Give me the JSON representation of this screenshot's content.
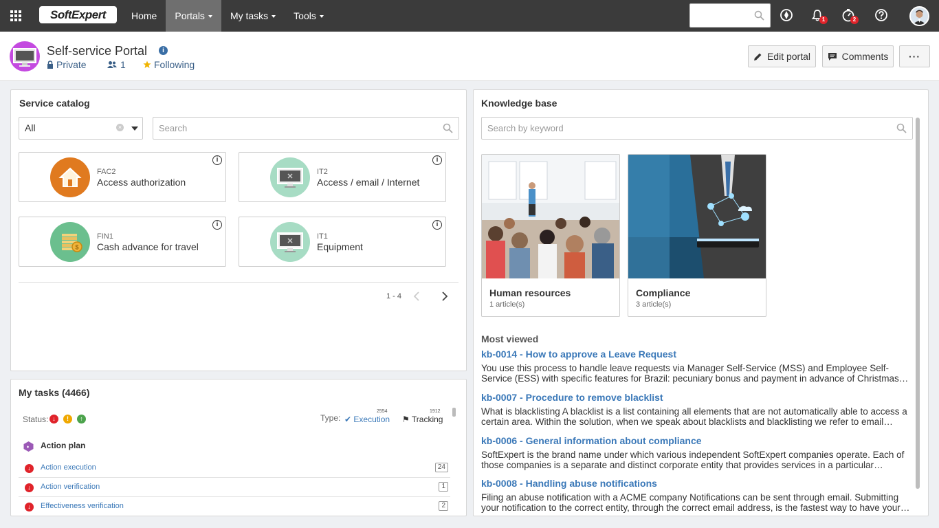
{
  "topbar": {
    "logo": "SoftExpert",
    "nav": [
      {
        "label": "Home",
        "caret": false,
        "active": false
      },
      {
        "label": "Portals",
        "caret": true,
        "active": true
      },
      {
        "label": "My tasks",
        "caret": true,
        "active": false
      },
      {
        "label": "Tools",
        "caret": true,
        "active": false
      }
    ],
    "notifications_badge": "1",
    "timer_badge": "2"
  },
  "header": {
    "title": "Self-service Portal",
    "privacy": "Private",
    "members": "1",
    "following": "Following",
    "edit_label": "Edit portal",
    "comments_label": "Comments",
    "more_label": "···"
  },
  "catalog": {
    "title": "Service catalog",
    "filter_value": "All",
    "search_placeholder": "Search",
    "items": [
      {
        "code": "FAC2",
        "name": "Access authorization",
        "icon": "house-icon",
        "color": "#e07a1f"
      },
      {
        "code": "IT2",
        "name": "Access / email / Internet",
        "icon": "monitor-icon",
        "color": "#a7dcc4"
      },
      {
        "code": "FIN1",
        "name": "Cash advance for travel",
        "icon": "coins-icon",
        "color": "#6bbf8e"
      },
      {
        "code": "IT1",
        "name": "Equipment",
        "icon": "monitor-icon",
        "color": "#a7dcc4"
      }
    ],
    "pager": "1 - 4"
  },
  "tasks": {
    "title": "My tasks (4466)",
    "status_label": "Status:",
    "type_label": "Type:",
    "execution_label": "Execution",
    "execution_count": "2554",
    "tracking_label": "Tracking",
    "tracking_count": "1912",
    "group": "Action plan",
    "rows": [
      {
        "label": "Action execution",
        "count": "24"
      },
      {
        "label": "Action verification",
        "count": "1"
      },
      {
        "label": "Effectiveness verification",
        "count": "2"
      }
    ]
  },
  "kb": {
    "title": "Knowledge base",
    "search_placeholder": "Search by keyword",
    "categories": [
      {
        "name": "Human resources",
        "count": "1 article(s)"
      },
      {
        "name": "Compliance",
        "count": "3 article(s)"
      }
    ],
    "most_viewed_title": "Most viewed",
    "articles": [
      {
        "title": "kb-0014 - How to approve a Leave Request",
        "text": "You use this process to handle leave requests via Manager Self-Service (MSS) and Employee Self-Service (ESS) with specific features for Brazil: pecuniary bonus and payment in advance of Christmas allowance. The..."
      },
      {
        "title": "kb-0007 - Procedure to remove blacklist",
        "text": "What is blacklisting A blacklist is a list containing all elements that are not automatically able to access a certain area. Within the solution, when we speak about blacklists and blacklisting we refer to email blacklists. In..."
      },
      {
        "title": "kb-0006 - General information about compliance",
        "text": "SoftExpert is the brand name under which various independent SoftExpert companies operate. Each of those companies is a separate and distinct corporate entity that provides services in a particular geographic area. To..."
      },
      {
        "title": "kb-0008 - Handling abuse notifications",
        "text": "Filing an abuse notification with a ACME company Notifications can be sent through email. Submitting your notification to the correct entity, through the correct email address, is the fastest way to have your notification..."
      }
    ]
  }
}
